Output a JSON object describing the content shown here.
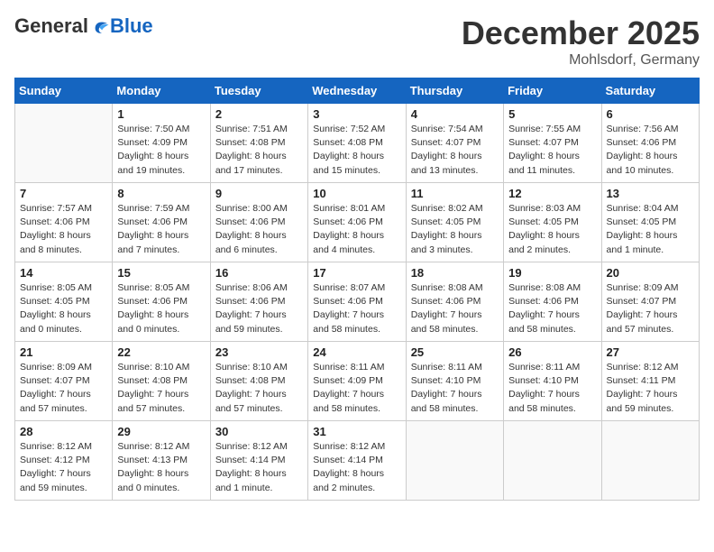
{
  "header": {
    "logo": {
      "general": "General",
      "blue": "Blue"
    },
    "month": "December 2025",
    "location": "Mohlsdorf, Germany"
  },
  "weekdays": [
    "Sunday",
    "Monday",
    "Tuesday",
    "Wednesday",
    "Thursday",
    "Friday",
    "Saturday"
  ],
  "weeks": [
    [
      {
        "day": "",
        "info": ""
      },
      {
        "day": "1",
        "info": "Sunrise: 7:50 AM\nSunset: 4:09 PM\nDaylight: 8 hours\nand 19 minutes."
      },
      {
        "day": "2",
        "info": "Sunrise: 7:51 AM\nSunset: 4:08 PM\nDaylight: 8 hours\nand 17 minutes."
      },
      {
        "day": "3",
        "info": "Sunrise: 7:52 AM\nSunset: 4:08 PM\nDaylight: 8 hours\nand 15 minutes."
      },
      {
        "day": "4",
        "info": "Sunrise: 7:54 AM\nSunset: 4:07 PM\nDaylight: 8 hours\nand 13 minutes."
      },
      {
        "day": "5",
        "info": "Sunrise: 7:55 AM\nSunset: 4:07 PM\nDaylight: 8 hours\nand 11 minutes."
      },
      {
        "day": "6",
        "info": "Sunrise: 7:56 AM\nSunset: 4:06 PM\nDaylight: 8 hours\nand 10 minutes."
      }
    ],
    [
      {
        "day": "7",
        "info": "Sunrise: 7:57 AM\nSunset: 4:06 PM\nDaylight: 8 hours\nand 8 minutes."
      },
      {
        "day": "8",
        "info": "Sunrise: 7:59 AM\nSunset: 4:06 PM\nDaylight: 8 hours\nand 7 minutes."
      },
      {
        "day": "9",
        "info": "Sunrise: 8:00 AM\nSunset: 4:06 PM\nDaylight: 8 hours\nand 6 minutes."
      },
      {
        "day": "10",
        "info": "Sunrise: 8:01 AM\nSunset: 4:06 PM\nDaylight: 8 hours\nand 4 minutes."
      },
      {
        "day": "11",
        "info": "Sunrise: 8:02 AM\nSunset: 4:05 PM\nDaylight: 8 hours\nand 3 minutes."
      },
      {
        "day": "12",
        "info": "Sunrise: 8:03 AM\nSunset: 4:05 PM\nDaylight: 8 hours\nand 2 minutes."
      },
      {
        "day": "13",
        "info": "Sunrise: 8:04 AM\nSunset: 4:05 PM\nDaylight: 8 hours\nand 1 minute."
      }
    ],
    [
      {
        "day": "14",
        "info": "Sunrise: 8:05 AM\nSunset: 4:05 PM\nDaylight: 8 hours\nand 0 minutes."
      },
      {
        "day": "15",
        "info": "Sunrise: 8:05 AM\nSunset: 4:06 PM\nDaylight: 8 hours\nand 0 minutes."
      },
      {
        "day": "16",
        "info": "Sunrise: 8:06 AM\nSunset: 4:06 PM\nDaylight: 7 hours\nand 59 minutes."
      },
      {
        "day": "17",
        "info": "Sunrise: 8:07 AM\nSunset: 4:06 PM\nDaylight: 7 hours\nand 58 minutes."
      },
      {
        "day": "18",
        "info": "Sunrise: 8:08 AM\nSunset: 4:06 PM\nDaylight: 7 hours\nand 58 minutes."
      },
      {
        "day": "19",
        "info": "Sunrise: 8:08 AM\nSunset: 4:06 PM\nDaylight: 7 hours\nand 58 minutes."
      },
      {
        "day": "20",
        "info": "Sunrise: 8:09 AM\nSunset: 4:07 PM\nDaylight: 7 hours\nand 57 minutes."
      }
    ],
    [
      {
        "day": "21",
        "info": "Sunrise: 8:09 AM\nSunset: 4:07 PM\nDaylight: 7 hours\nand 57 minutes."
      },
      {
        "day": "22",
        "info": "Sunrise: 8:10 AM\nSunset: 4:08 PM\nDaylight: 7 hours\nand 57 minutes."
      },
      {
        "day": "23",
        "info": "Sunrise: 8:10 AM\nSunset: 4:08 PM\nDaylight: 7 hours\nand 57 minutes."
      },
      {
        "day": "24",
        "info": "Sunrise: 8:11 AM\nSunset: 4:09 PM\nDaylight: 7 hours\nand 58 minutes."
      },
      {
        "day": "25",
        "info": "Sunrise: 8:11 AM\nSunset: 4:10 PM\nDaylight: 7 hours\nand 58 minutes."
      },
      {
        "day": "26",
        "info": "Sunrise: 8:11 AM\nSunset: 4:10 PM\nDaylight: 7 hours\nand 58 minutes."
      },
      {
        "day": "27",
        "info": "Sunrise: 8:12 AM\nSunset: 4:11 PM\nDaylight: 7 hours\nand 59 minutes."
      }
    ],
    [
      {
        "day": "28",
        "info": "Sunrise: 8:12 AM\nSunset: 4:12 PM\nDaylight: 7 hours\nand 59 minutes."
      },
      {
        "day": "29",
        "info": "Sunrise: 8:12 AM\nSunset: 4:13 PM\nDaylight: 8 hours\nand 0 minutes."
      },
      {
        "day": "30",
        "info": "Sunrise: 8:12 AM\nSunset: 4:14 PM\nDaylight: 8 hours\nand 1 minute."
      },
      {
        "day": "31",
        "info": "Sunrise: 8:12 AM\nSunset: 4:14 PM\nDaylight: 8 hours\nand 2 minutes."
      },
      {
        "day": "",
        "info": ""
      },
      {
        "day": "",
        "info": ""
      },
      {
        "day": "",
        "info": ""
      }
    ]
  ]
}
